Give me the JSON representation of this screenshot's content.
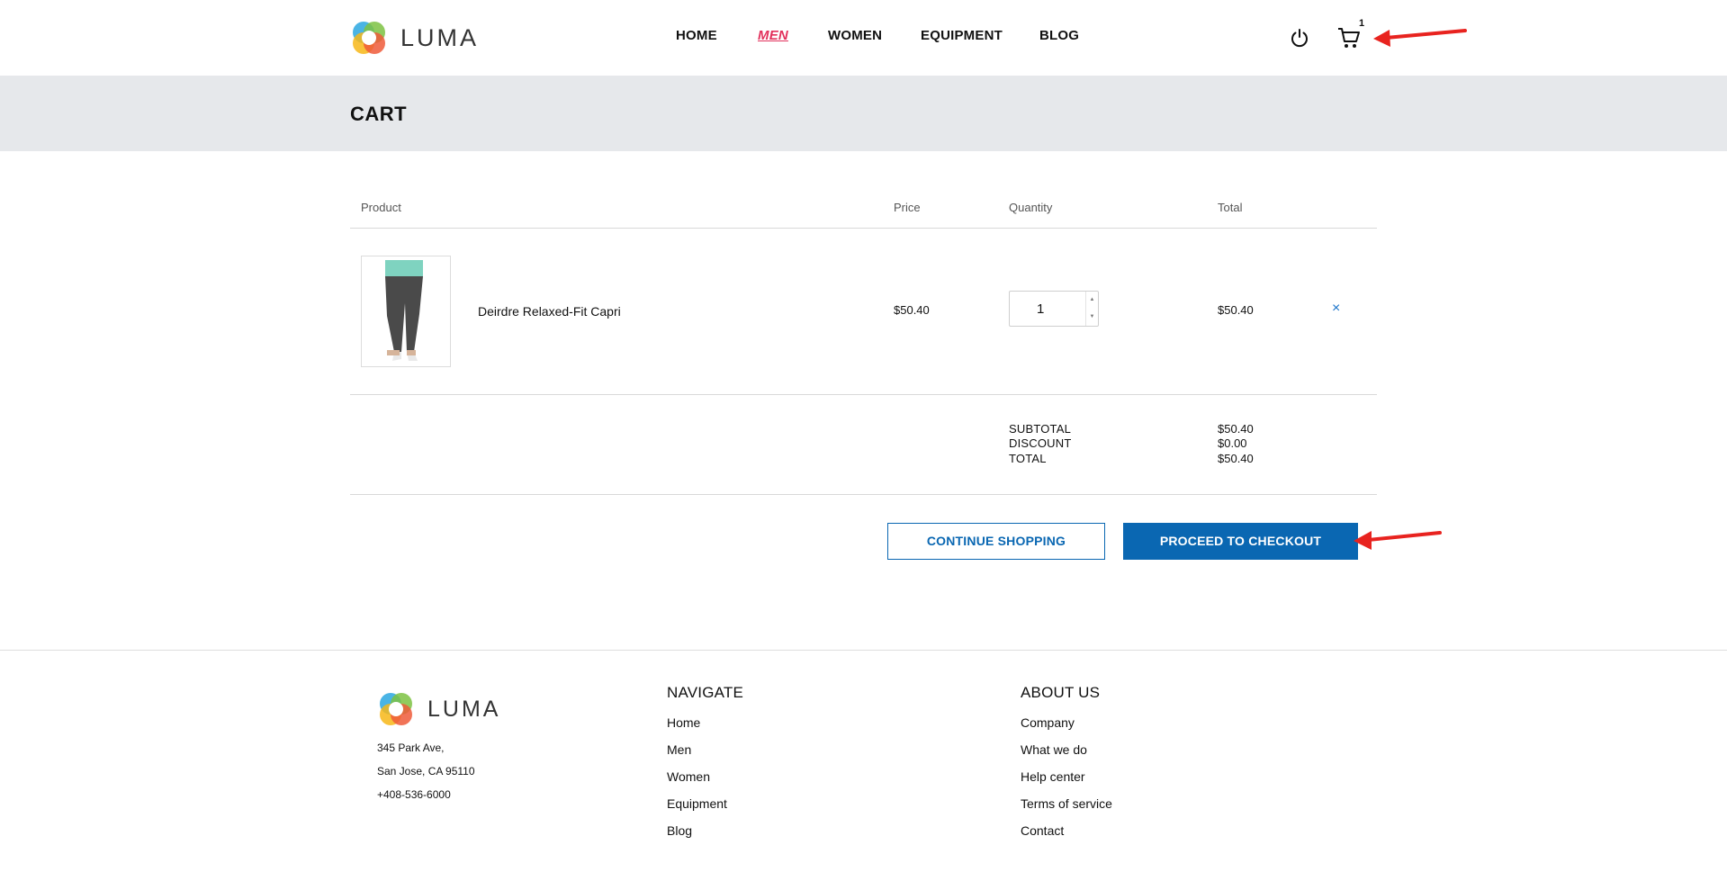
{
  "header": {
    "brand": "LUMA",
    "nav": [
      "HOME",
      "MEN",
      "WOMEN",
      "EQUIPMENT",
      "BLOG"
    ],
    "active_nav": "MEN",
    "cart_count": "1",
    "accent_color": "#e2315c"
  },
  "page": {
    "title": "CART"
  },
  "cart": {
    "columns": [
      "Product",
      "Price",
      "Quantity",
      "Total"
    ],
    "items": [
      {
        "name": "Deirdre Relaxed-Fit Capri",
        "price": "$50.40",
        "quantity": "1",
        "total": "$50.40",
        "remove": "×"
      }
    ],
    "summary": [
      {
        "label": "SUBTOTAL",
        "value": "$50.40"
      },
      {
        "label": "DISCOUNT",
        "value": "$0.00"
      },
      {
        "label": "TOTAL",
        "value": "$50.40"
      }
    ],
    "continue_label": "CONTINUE SHOPPING",
    "checkout_label": "PROCEED TO CHECKOUT",
    "button_color": "#0a67b2"
  },
  "footer": {
    "brand": "LUMA",
    "address": [
      "345 Park Ave,",
      "San Jose, CA 95110",
      "+408-536-6000"
    ],
    "navigate_title": "NAVIGATE",
    "navigate_links": [
      "Home",
      "Men",
      "Women",
      "Equipment",
      "Blog"
    ],
    "about_title": "ABOUT US",
    "about_links": [
      "Company",
      "What we do",
      "Help center",
      "Terms of service",
      "Contact"
    ]
  },
  "annotations": {
    "arrow_color": "#e8231f"
  }
}
